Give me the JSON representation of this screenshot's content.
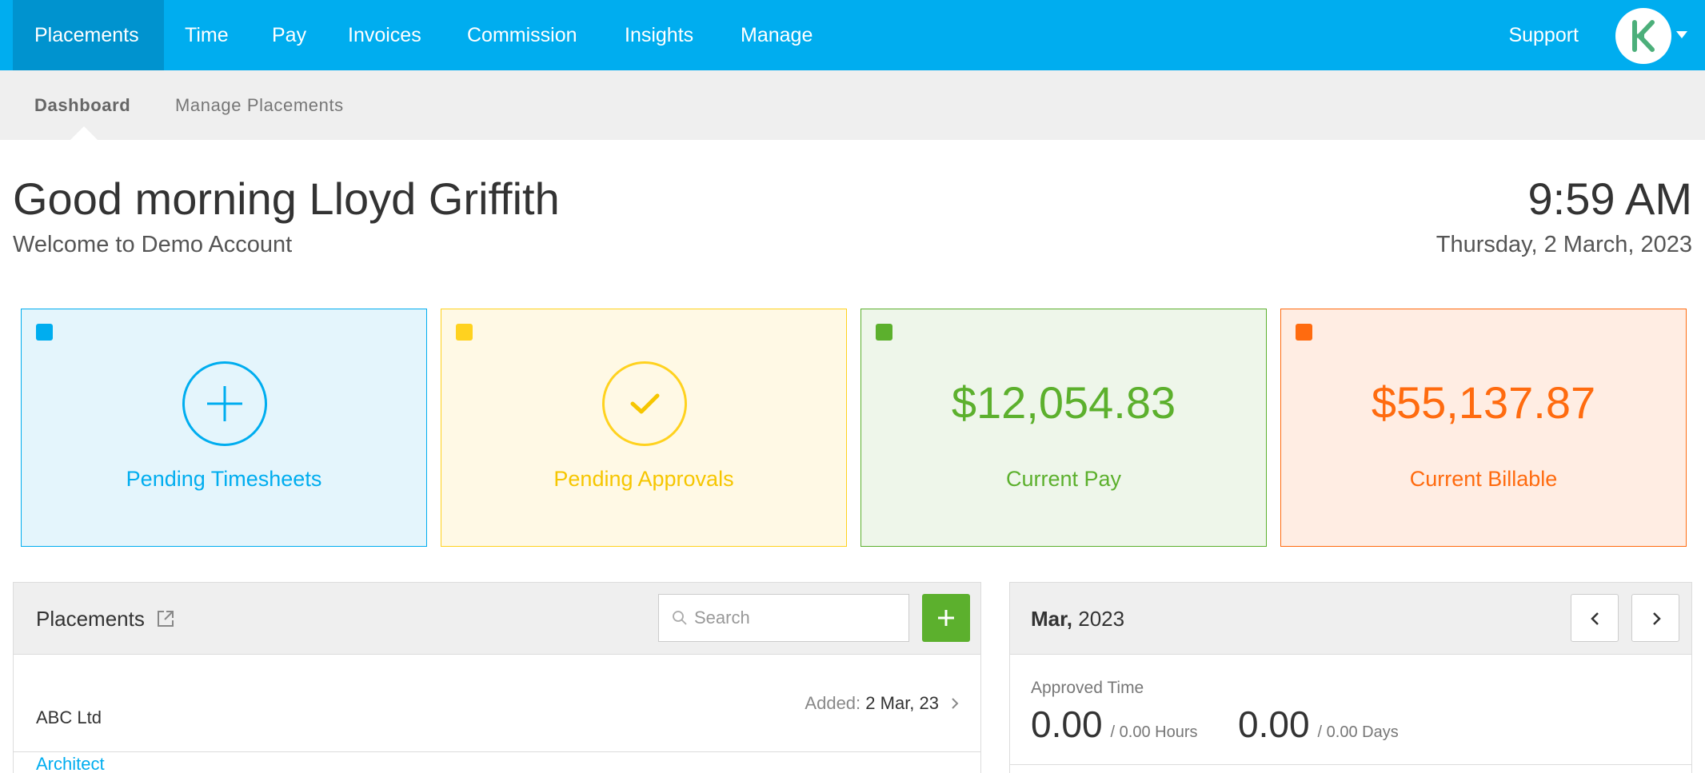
{
  "nav": {
    "tabs": [
      {
        "label": "Placements",
        "active": true
      },
      {
        "label": "Time"
      },
      {
        "label": "Pay"
      },
      {
        "label": "Invoices"
      },
      {
        "label": "Commission"
      },
      {
        "label": "Insights"
      },
      {
        "label": "Manage"
      }
    ],
    "support_label": "Support",
    "avatar_icon": "company-logo-icon",
    "accent": "#00adef"
  },
  "subnav": {
    "items": [
      {
        "label": "Dashboard",
        "active": true
      },
      {
        "label": "Manage Placements"
      }
    ]
  },
  "header": {
    "greeting": "Good morning Lloyd Griffith",
    "welcome": "Welcome to Demo Account",
    "time": "9:59 AM",
    "date": "Thursday, 2 March, 2023"
  },
  "cards": [
    {
      "label": "Pending Timesheets",
      "icon": "plus-icon",
      "color": "#00adef"
    },
    {
      "label": "Pending Approvals",
      "icon": "check-icon",
      "color": "#ffd21f"
    },
    {
      "amount": "$12,054.83",
      "label": "Current Pay",
      "color": "#5cb02d"
    },
    {
      "amount": "$55,137.87",
      "label": "Current Billable",
      "color": "#ff6b0f"
    }
  ],
  "placements_panel": {
    "title": "Placements",
    "search_placeholder": "Search",
    "rows": [
      {
        "role": "Architect",
        "company": "ABC Ltd",
        "added_label": "Added:",
        "added_date": "2 Mar, 23"
      }
    ]
  },
  "calendar_panel": {
    "month": "Mar,",
    "year": "2023",
    "approved_label": "Approved Time",
    "hours_value": "0.00",
    "hours_total": "/ 0.00 Hours",
    "days_value": "0.00",
    "days_total": "/ 0.00 Days"
  }
}
